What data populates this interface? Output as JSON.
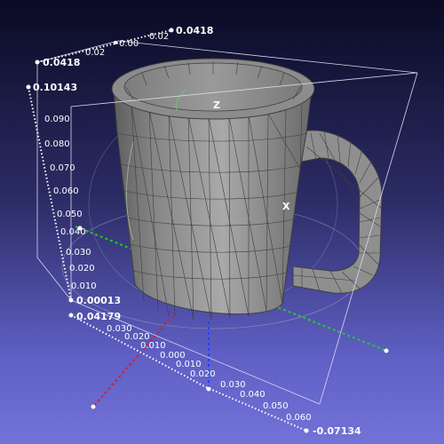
{
  "viewport": {
    "background_top": "#0a0a24",
    "background_bottom": "#7272d8"
  },
  "object": {
    "kind": "mug",
    "color": "#9a9a9a",
    "edge_color": "#3e3e3e"
  },
  "axis_labels": {
    "x": "X",
    "z": "Z"
  },
  "axis_colors": {
    "x": "#22cc22",
    "y": "#cc2233",
    "z": "#2244ff"
  },
  "axes": {
    "top": {
      "ticks": [
        "0.02",
        "0.00",
        "0.02"
      ],
      "min": "0.0418",
      "max": "0.0418"
    },
    "vertical": {
      "ticks": [
        "0.090",
        "0.080",
        "0.070",
        "0.060",
        "0.050",
        "0.040",
        "0.030",
        "0.020",
        "0.010"
      ],
      "max": "0.10143",
      "min": "0.00013"
    },
    "front_left": {
      "ticks": [
        "0.030",
        "0.020",
        "0.010",
        "0.000",
        "0.010",
        "0.020"
      ],
      "max": "0.04179"
    },
    "bottom": {
      "ticks": [
        "0.030",
        "0.040",
        "0.050",
        "0.060"
      ],
      "min": "-0.07134"
    }
  }
}
